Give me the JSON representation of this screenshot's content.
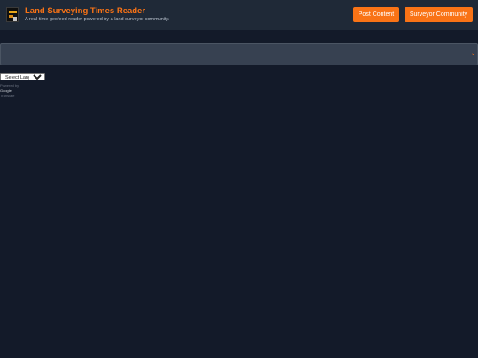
{
  "header": {
    "title": "Land Surveying Times Reader",
    "subtitle": "A real-time geofeed reader powered by a land surveyor community.",
    "post_button": "Post Content",
    "community_button": "Surveyor Community"
  },
  "panel": {
    "chevron": "⌄"
  },
  "translate": {
    "select_label": "Select Language",
    "powered_by": "Powered by",
    "google": "Google",
    "translate": "Translate"
  },
  "colors": {
    "accent": "#f97316",
    "header_bg": "#1f2937",
    "page_bg": "#131a29",
    "panel_bg": "#374151"
  },
  "icons": {
    "logo": "surveyor-logo-icon",
    "chevron": "chevron-down-icon"
  }
}
